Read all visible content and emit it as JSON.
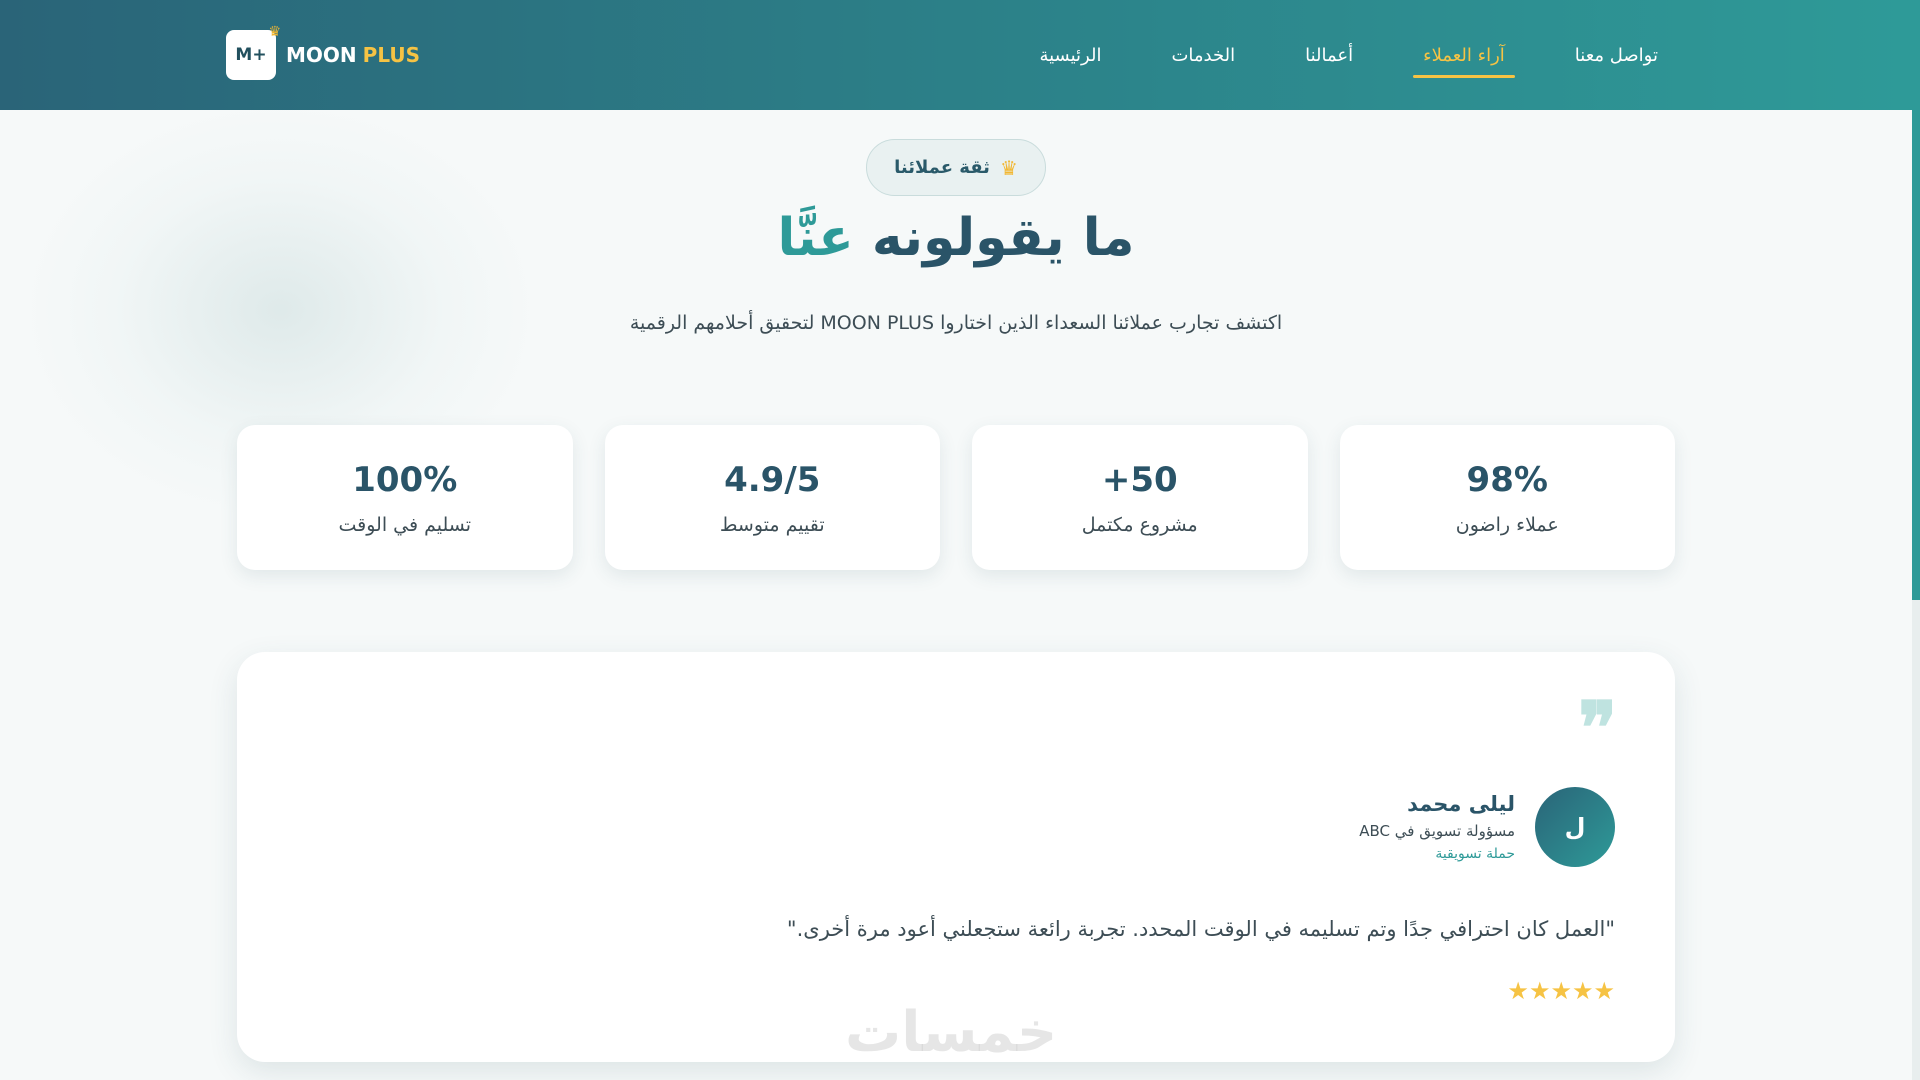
{
  "header": {
    "logo_mark": "M+",
    "logo_word_1": "MOON",
    "logo_word_2": "PLUS",
    "nav": [
      {
        "label": "تواصل معنا"
      },
      {
        "label": "آراء العملاء",
        "active": true
      },
      {
        "label": "أعمالنا"
      },
      {
        "label": "الخدمات"
      },
      {
        "label": "الرئيسية"
      }
    ]
  },
  "hero": {
    "badge_label": "ثقة عملائنا",
    "badge_icon": "crown-icon",
    "title_main": "ما يقولونه",
    "title_accent": "عنَّا",
    "subtitle": "اكتشف تجارب عملائنا السعداء الذين اختاروا MOON PLUS لتحقيق أحلامهم الرقمية"
  },
  "stats": [
    {
      "value": "98%",
      "label": "عملاء راضون"
    },
    {
      "value": "+50",
      "label": "مشروع مكتمل"
    },
    {
      "value": "4.9/5",
      "label": "تقييم متوسط"
    },
    {
      "value": "100%",
      "label": "تسليم في الوقت"
    }
  ],
  "testimonial": {
    "avatar_letter": "ل",
    "name": "ليلى محمد",
    "role": "مسؤولة تسويق في ABC",
    "project": "حملة تسويقية",
    "quote": "\"العمل كان احترافي جدًا وتم تسليمه في الوقت المحدد. تجربة رائعة ستجعلني أعود مرة أخرى.\"",
    "rating": 5,
    "stars": "★★★★★"
  },
  "watermark": "خمسات",
  "colors": {
    "header_start": "#2a6478",
    "header_end": "#2e9a98",
    "accent": "#2e9a98",
    "gold": "#f6c344",
    "text_dark": "#2a5468"
  }
}
